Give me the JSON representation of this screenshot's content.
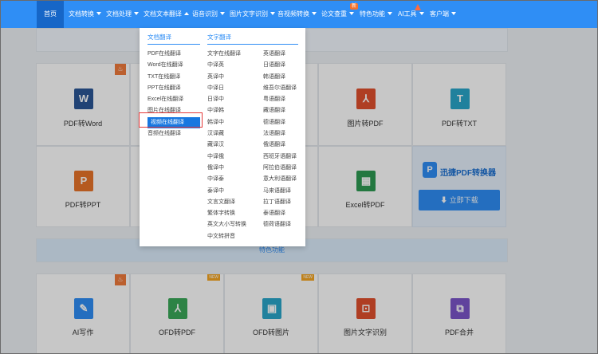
{
  "nav": {
    "items": [
      {
        "label": "首页",
        "caret": ""
      },
      {
        "label": "文档转换",
        "caret": "down"
      },
      {
        "label": "文档处理",
        "caret": "down"
      },
      {
        "label": "文档文本翻译",
        "caret": "up"
      },
      {
        "label": "语音识别",
        "caret": "down"
      },
      {
        "label": "图片文字识别",
        "caret": "down"
      },
      {
        "label": "音视频转换",
        "caret": "down"
      },
      {
        "label": "论文查重",
        "caret": "down"
      },
      {
        "label": "特色功能",
        "caret": "down"
      },
      {
        "label": "AI工具",
        "caret": "down"
      },
      {
        "label": "客户端",
        "caret": "down"
      }
    ],
    "new_badge": "新"
  },
  "dropdown": {
    "doc_translate": {
      "heading": "文档翻译",
      "items": [
        "PDF在线翻译",
        "Word在线翻译",
        "TXT在线翻译",
        "PPT在线翻译",
        "Excel在线翻译",
        "图片在线翻译",
        "视频在线翻译",
        "音频在线翻译"
      ],
      "selected_index": 6
    },
    "text_translate": {
      "heading": "文字翻译",
      "col1": [
        "文字在线翻译",
        "中译英",
        "英译中",
        "中译日",
        "日译中",
        "中译韩",
        "韩译中",
        "汉译藏",
        "藏译汉",
        "中译俄",
        "俄译中",
        "中译泰",
        "泰译中",
        "文言文翻译",
        "繁体字转换",
        "英文大小写转换",
        "中文转拼音"
      ],
      "col2": [
        "英语翻译",
        "日语翻译",
        "韩语翻译",
        "维吾尔语翻译",
        "粤语翻译",
        "藏语翻译",
        "德语翻译",
        "法语翻译",
        "俄语翻译",
        "西班牙语翻译",
        "阿拉伯语翻译",
        "意大利语翻译",
        "马来语翻译",
        "拉丁语翻译",
        "泰语翻译",
        "德荷语翻译"
      ]
    }
  },
  "cards_row1": [
    {
      "label": "PDF转Word",
      "glyph": "W",
      "color": "#2b5797",
      "tag": "hot",
      "icon": "word-icon"
    },
    {
      "label": "",
      "glyph": "",
      "color": "",
      "tag": "",
      "icon": ""
    },
    {
      "label": "",
      "glyph": "",
      "color": "",
      "tag": "",
      "icon": ""
    },
    {
      "label": "图片转PDF",
      "glyph": "⅄",
      "color": "#e0502e",
      "tag": "",
      "icon": "pdf-icon"
    },
    {
      "label": "PDF转TXT",
      "glyph": "T",
      "color": "#2aa6c9",
      "tag": "",
      "icon": "txt-icon"
    }
  ],
  "cards_row2": [
    {
      "label": "PDF转PPT",
      "glyph": "P",
      "color": "#e8742a",
      "tag": "",
      "icon": "ppt-icon"
    },
    {
      "label": "",
      "glyph": "",
      "color": "",
      "tag": "",
      "icon": ""
    },
    {
      "label": "",
      "glyph": "",
      "color": "",
      "tag": "",
      "icon": ""
    },
    {
      "label": "Excel转PDF",
      "glyph": "▦",
      "color": "#2e9a52",
      "tag": "",
      "icon": "excel-icon"
    }
  ],
  "promo": {
    "brand": "迅捷PDF转换器",
    "logo": "P",
    "download": "⬇ 立即下载"
  },
  "special": {
    "title": "特色功能"
  },
  "cards_row3": [
    {
      "label": "AI写作",
      "glyph": "✎",
      "color": "#2f8ef5",
      "tag": "hot",
      "icon": "ai-write-icon"
    },
    {
      "label": "OFD转PDF",
      "glyph": "⅄",
      "color": "#3aa859",
      "tag": "NEW",
      "icon": "ofd-pdf-icon"
    },
    {
      "label": "OFD转图片",
      "glyph": "▣",
      "color": "#2aa6c9",
      "tag": "NEW",
      "icon": "ofd-image-icon"
    },
    {
      "label": "图片文字识别",
      "glyph": "⊡",
      "color": "#e0502e",
      "tag": "",
      "icon": "ocr-icon"
    },
    {
      "label": "PDF合并",
      "glyph": "⧉",
      "color": "#7b55c9",
      "tag": "",
      "icon": "pdf-merge-icon"
    }
  ]
}
